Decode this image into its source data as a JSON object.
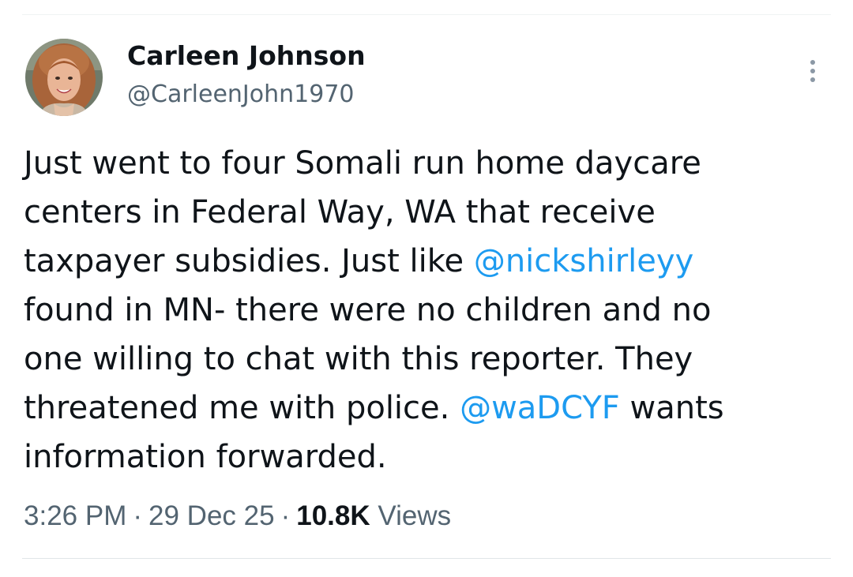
{
  "author": {
    "display_name": "Carleen Johnson",
    "handle": "@CarleenJohn1970"
  },
  "menu": {
    "icon": "more-vertical-icon"
  },
  "tweet": {
    "lines": [
      {
        "a": "Just went to four Somali run home daycare"
      },
      {
        "a": "centers in Federal Way, WA that receive"
      },
      {
        "a": "taxpayer subsidies. Just like ",
        "mention": "@nickshirleyy"
      },
      {
        "a": "found in MN- there were no children and no"
      },
      {
        "a": "one willing to chat with this reporter. They"
      },
      {
        "a": "threatened me with police. ",
        "mention": "@waDCYF",
        "b": " wants"
      },
      {
        "a": "information forwarded."
      }
    ]
  },
  "meta": {
    "time": "3:26 PM",
    "date": "29 Dec 25",
    "separator": "·",
    "views_count": "10.8K",
    "views_label": "Views"
  },
  "colors": {
    "mention": "#1d9bf0",
    "secondary_text": "#536471",
    "primary_text": "#0f1419"
  }
}
